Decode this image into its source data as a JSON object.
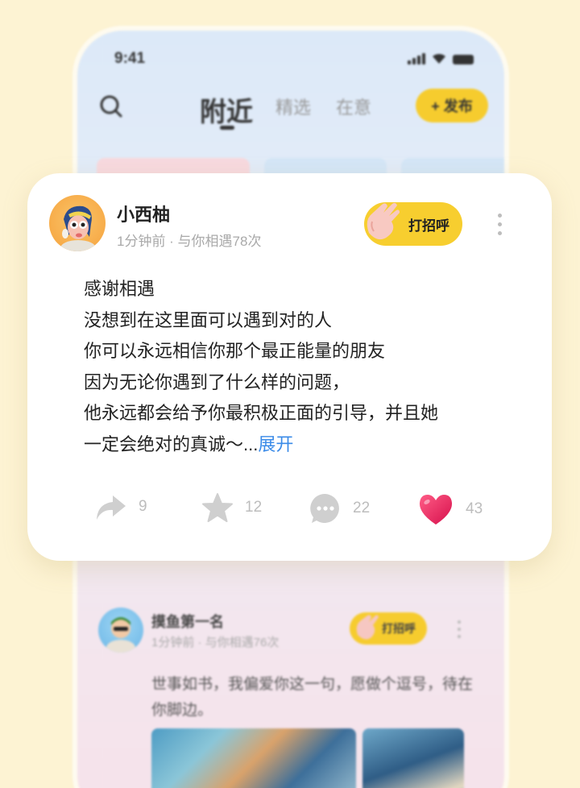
{
  "status_bar": {
    "time": "9:41"
  },
  "header": {
    "tabs": [
      {
        "label": "附近",
        "active": true
      },
      {
        "label": "精选",
        "active": false
      },
      {
        "label": "在意",
        "active": false
      }
    ],
    "publish_label": "+ 发布"
  },
  "featured_post": {
    "username": "小西柚",
    "meta": "1分钟前 · 与你相遇78次",
    "greet_label": "打招呼",
    "content_lines": [
      "感谢相遇",
      "没想到在这里面可以遇到对的人",
      "你可以永远相信你那个最正能量的朋友",
      "因为无论你遇到了什么样的问题，",
      "他永远都会给予你最积极正面的引导，并且她",
      "一定会绝对的真诚～..."
    ],
    "expand_label": "展开",
    "actions": {
      "share_count": "9",
      "favorite_count": "12",
      "comment_count": "22",
      "like_count": "43"
    }
  },
  "second_post": {
    "username": "摸鱼第一名",
    "meta": "1分钟前 · 与你相遇76次",
    "greet_label": "打招呼",
    "content": "世事如书，我偏爱你这一句，愿做个逗号，待在你脚边。"
  },
  "colors": {
    "background": "#FDF3D3",
    "accent_yellow": "#F7CE2F",
    "link_blue": "#3B8BE8",
    "heart_pink": "#E8205F"
  }
}
